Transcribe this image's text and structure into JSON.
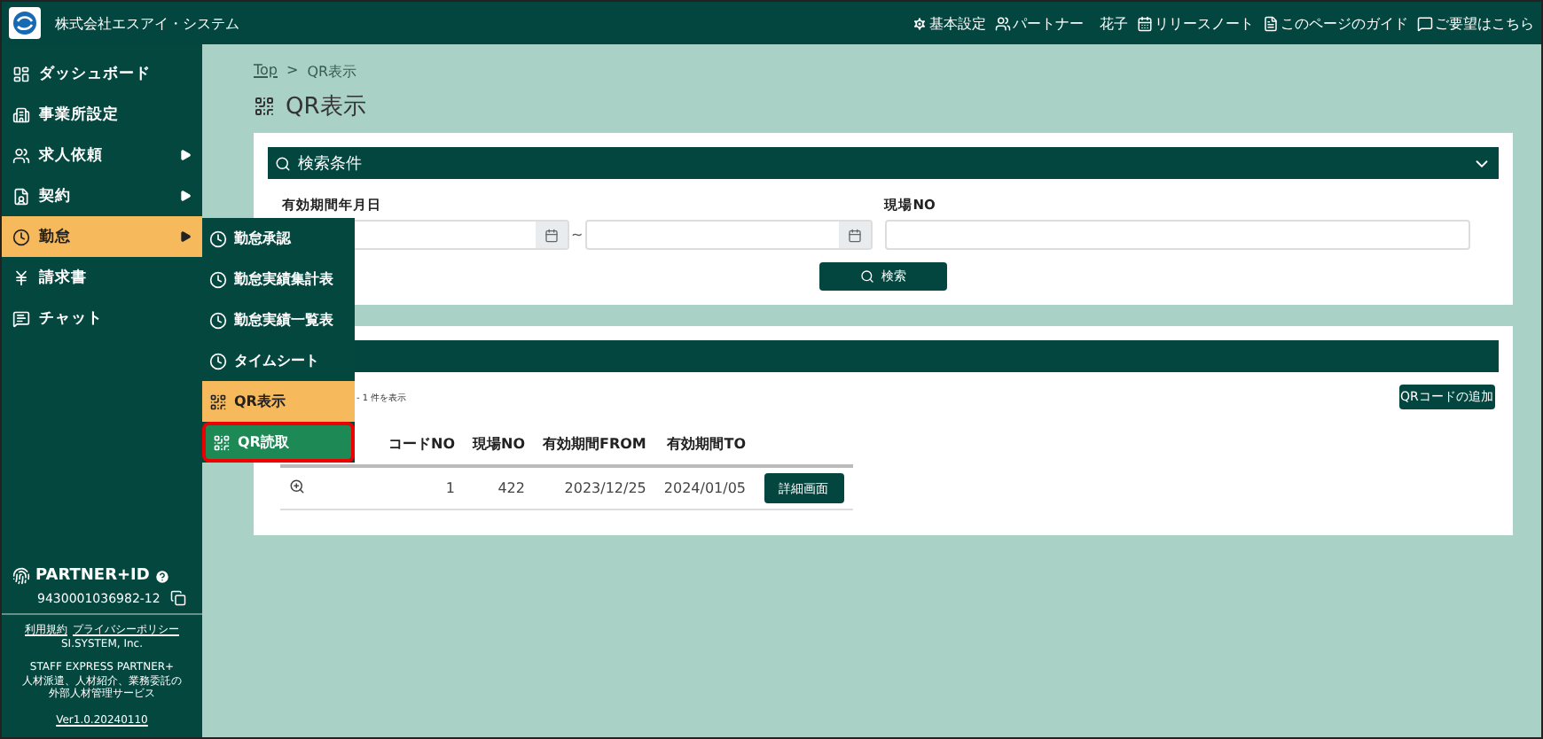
{
  "header": {
    "company": "株式会社エスアイ・システム",
    "links": [
      {
        "kind": "settings",
        "label": "基本設定"
      },
      {
        "kind": "partner",
        "label": "パートナー"
      },
      {
        "kind": "name",
        "label": "花子"
      },
      {
        "kind": "release",
        "label": "リリースノート"
      },
      {
        "kind": "guide",
        "label": "このページのガイド"
      },
      {
        "kind": "feedback",
        "label": "ご要望はこちら"
      }
    ]
  },
  "sidebar": {
    "items": [
      {
        "kind": "dashboard",
        "label": "ダッシュボード",
        "submenu": false,
        "selected": false
      },
      {
        "kind": "office",
        "label": "事業所設定",
        "submenu": false,
        "selected": false
      },
      {
        "kind": "people",
        "label": "求人依頼",
        "submenu": true,
        "selected": false
      },
      {
        "kind": "doc",
        "label": "契約",
        "submenu": true,
        "selected": false
      },
      {
        "kind": "clock",
        "label": "勤怠",
        "submenu": true,
        "selected": true
      },
      {
        "kind": "yen",
        "label": "請求書",
        "submenu": false,
        "selected": false
      },
      {
        "kind": "chat",
        "label": "チャット",
        "submenu": false,
        "selected": false
      }
    ],
    "partner_id_label": "PARTNER+ID",
    "partner_id": "9430001036982-12",
    "links": [
      "利用規約",
      "プライバシーポリシー"
    ],
    "company": "SI.SYSTEM, Inc.",
    "product_lines": [
      "STAFF EXPRESS PARTNER+",
      "人材派遣、人材紹介、業務委託の",
      "外部人材管理サービス"
    ],
    "version": "Ver1.0.20240110"
  },
  "submenu": {
    "items": [
      {
        "kind": "clock",
        "label": "勤怠承認",
        "selected": false,
        "highlighted": false
      },
      {
        "kind": "clock",
        "label": "勤怠実績集計表",
        "selected": false,
        "highlighted": false
      },
      {
        "kind": "clock",
        "label": "勤怠実績一覧表",
        "selected": false,
        "highlighted": false
      },
      {
        "kind": "clock",
        "label": "タイムシート",
        "selected": false,
        "highlighted": false
      },
      {
        "kind": "qr",
        "label": "QR表示",
        "selected": true,
        "highlighted": false
      },
      {
        "kind": "qr",
        "label": "QR読取",
        "selected": false,
        "highlighted": true
      }
    ]
  },
  "breadcrumb": [
    "Top",
    "QR表示"
  ],
  "breadcrumb_separator": ">",
  "page_title": "QR表示",
  "search_panel": {
    "title": "検索条件",
    "expanded": true,
    "date_label": "有効期間年月日",
    "range_separator": "~",
    "site_label": "現場NO",
    "button": "検索"
  },
  "results_panel": {
    "count": "- 1 件を表示",
    "add_button": "QRコードの追加",
    "columns": [
      "コードNO",
      "現場NO",
      "有効期間FROM",
      "有効期間TO"
    ],
    "rows": [
      {
        "code": "1",
        "site": "422",
        "from": "2023/12/25",
        "to": "2024/01/05",
        "button": "詳細画面"
      }
    ]
  }
}
